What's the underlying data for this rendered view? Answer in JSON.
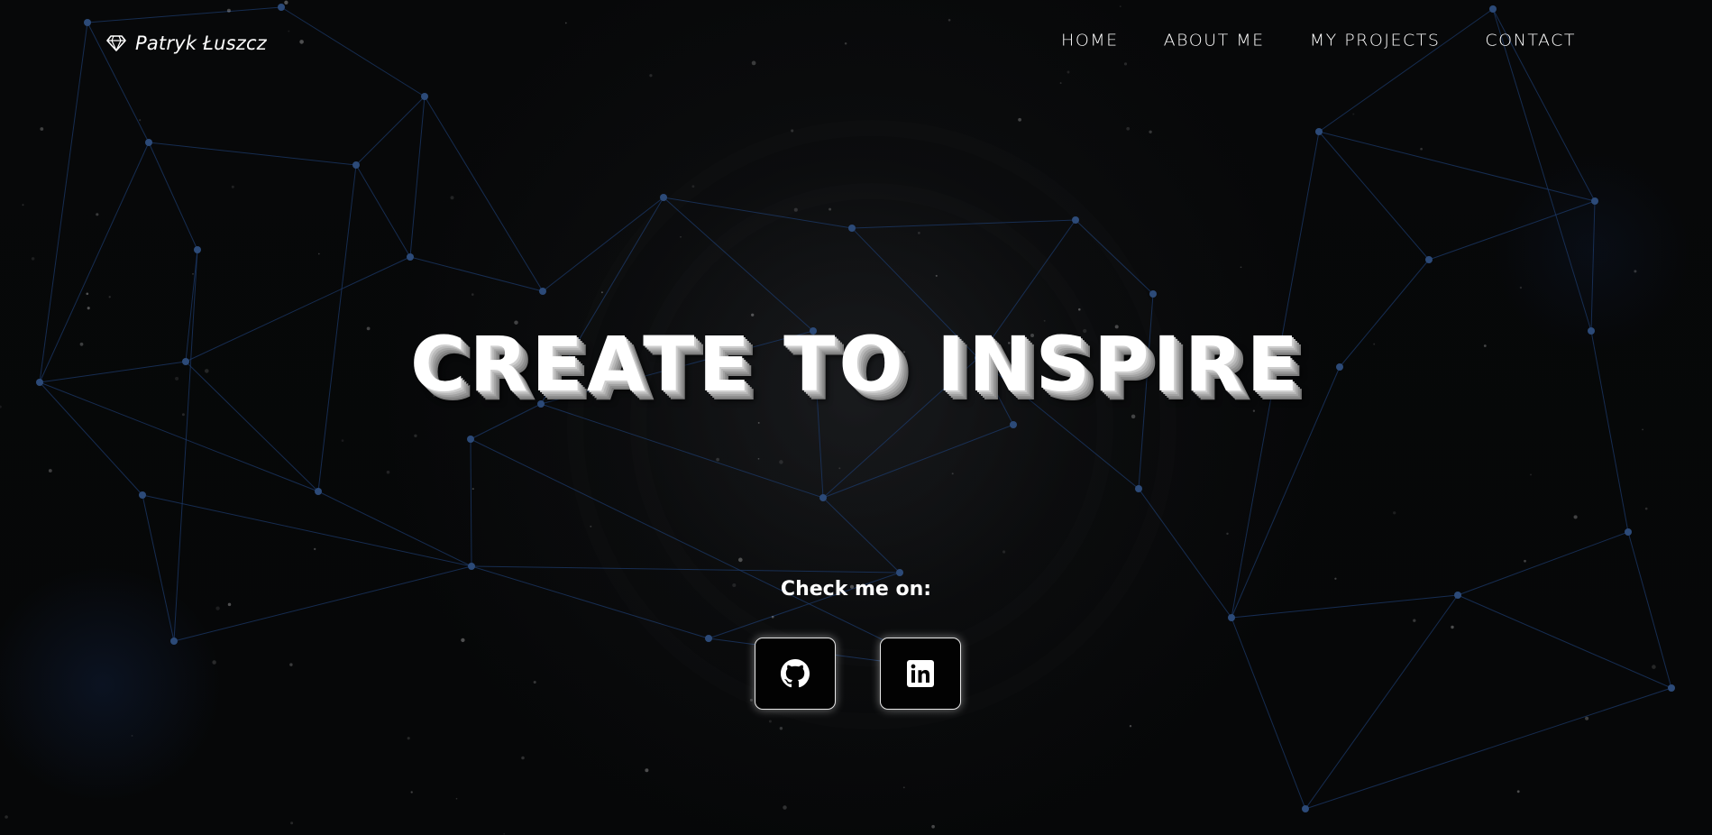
{
  "header": {
    "logo_icon": "diamond-icon",
    "logo_text": "Patryk Łuszcz",
    "menu": [
      {
        "label": "Home"
      },
      {
        "label": "About me"
      },
      {
        "label": "My projects"
      },
      {
        "label": "Contact"
      }
    ]
  },
  "hero": {
    "title": "CREATE TO INSPIRE"
  },
  "social": {
    "label": "Check me on:",
    "links": [
      {
        "icon": "github-icon"
      },
      {
        "icon": "linkedin-icon"
      }
    ]
  },
  "colors": {
    "background": "#050607",
    "network_line": "#1c3a6a",
    "network_node": "#2c4a78",
    "text": "#ffffff"
  }
}
